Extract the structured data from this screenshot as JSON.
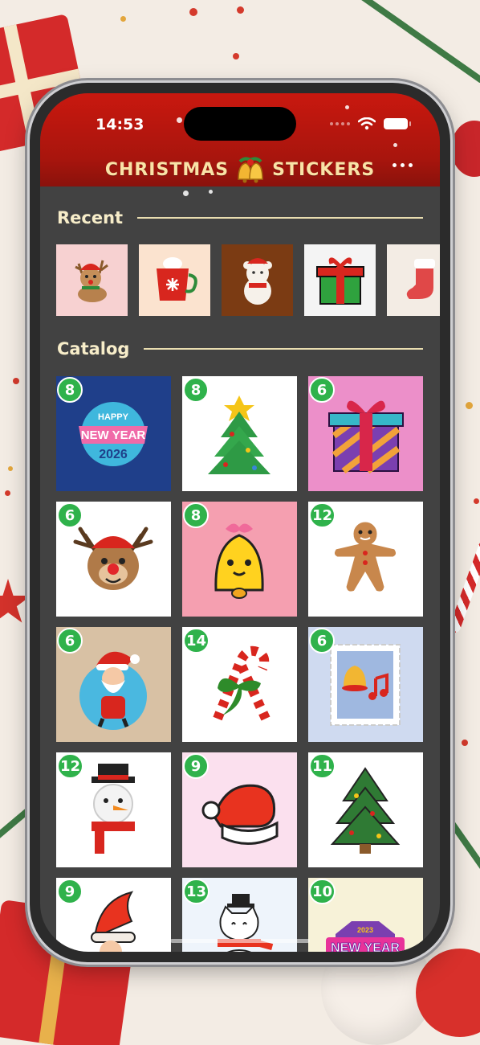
{
  "status_bar": {
    "time": "14:53"
  },
  "header": {
    "title_left": "CHRISTMAS",
    "title_right": "STICKERS",
    "title_icon": "bells-icon",
    "menu_icon": "more-dots-icon",
    "color": "#c41a10"
  },
  "recent": {
    "title": "Recent",
    "items": [
      {
        "icon": "reindeer-icon",
        "bg": "#f7d1d1"
      },
      {
        "icon": "hot-cocoa-mug-icon",
        "bg": "#fbe3cf"
      },
      {
        "icon": "teddy-bear-icon",
        "bg": "#7b3b13"
      },
      {
        "icon": "gift-box-icon",
        "bg": "#f4f4f4"
      },
      {
        "icon": "stocking-icon",
        "bg": "#f3ece4"
      }
    ]
  },
  "catalog": {
    "title": "Catalog",
    "packs": [
      {
        "count": "8",
        "icon": "happy-new-year-2026-icon",
        "bg": "#1f3f8a",
        "art_text": [
          "HAPPY",
          "NEW YEAR",
          "2026"
        ]
      },
      {
        "count": "8",
        "icon": "christmas-tree-icon",
        "bg": "#ffffff"
      },
      {
        "count": "6",
        "icon": "gift-box-icon",
        "bg": "#ec8fc9"
      },
      {
        "count": "6",
        "icon": "reindeer-icon",
        "bg": "#ffffff"
      },
      {
        "count": "8",
        "icon": "bell-icon",
        "bg": "#f59fb0"
      },
      {
        "count": "12",
        "icon": "gingerbread-man-icon",
        "bg": "#ffffff"
      },
      {
        "count": "6",
        "icon": "santa-icon",
        "bg": "#d8c1a4"
      },
      {
        "count": "14",
        "icon": "candy-cane-icon",
        "bg": "#ffffff"
      },
      {
        "count": "6",
        "icon": "bells-stamp-icon",
        "bg": "#cfdaf0"
      },
      {
        "count": "12",
        "icon": "snowman-icon",
        "bg": "#ffffff"
      },
      {
        "count": "9",
        "icon": "santa-hat-icon",
        "bg": "#fbe0ee"
      },
      {
        "count": "11",
        "icon": "christmas-tree-icon",
        "bg": "#ffffff"
      },
      {
        "count": "9",
        "icon": "santa-icon",
        "bg": "#ffffff"
      },
      {
        "count": "13",
        "icon": "cat-snowman-icon",
        "bg": "#eef4fb"
      },
      {
        "count": "10",
        "icon": "new-year-banner-icon",
        "bg": "#f7f2d8",
        "art_text": [
          "2023",
          "NEW YEAR"
        ]
      }
    ]
  }
}
